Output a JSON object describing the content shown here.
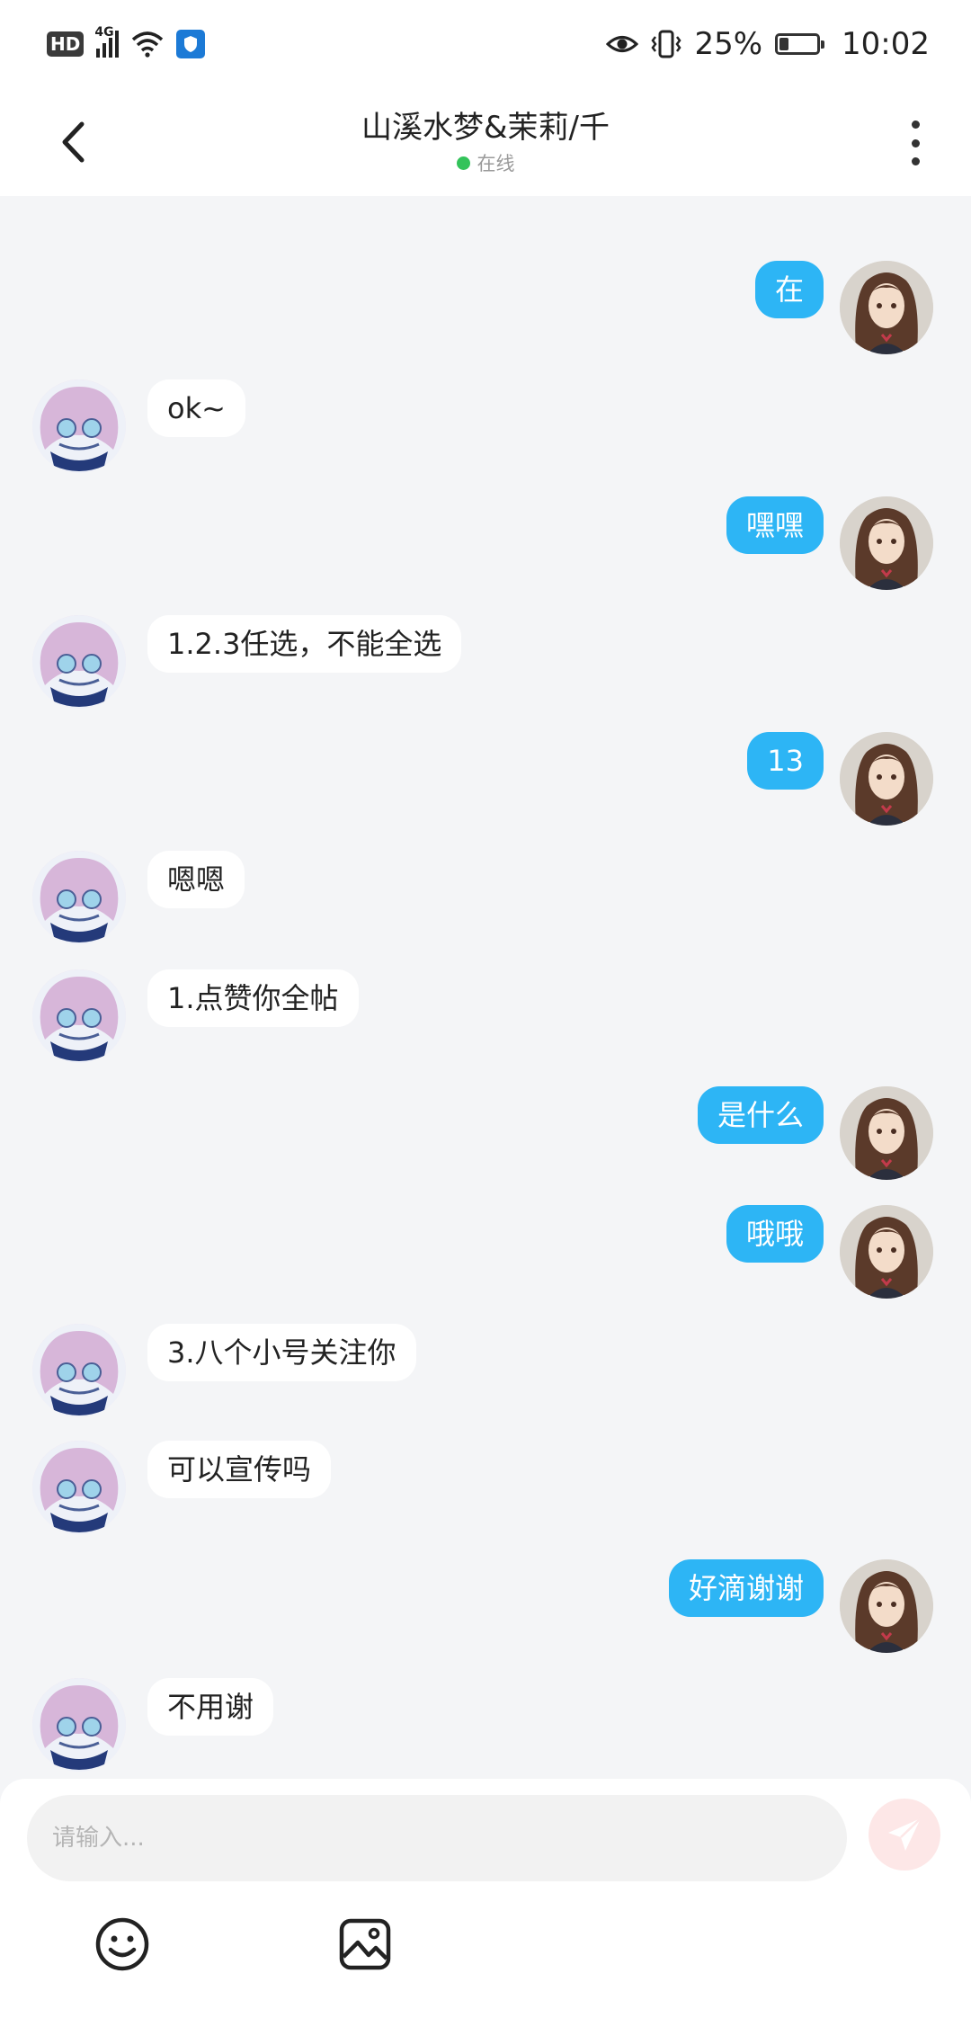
{
  "status_bar": {
    "hd": "HD",
    "network": "4G",
    "battery_percent": "25%",
    "battery_level": 0.25,
    "time": "10:02"
  },
  "header": {
    "title": "山溪水梦&茉莉/千",
    "status": "在线",
    "status_color": "#33c35a"
  },
  "messages": [
    {
      "side": "right",
      "text": "在"
    },
    {
      "side": "left",
      "text": "ok~"
    },
    {
      "side": "right",
      "text": "嘿嘿"
    },
    {
      "side": "left",
      "text": "1.2.3任选，不能全选"
    },
    {
      "side": "right",
      "text": "13"
    },
    {
      "side": "left",
      "text": "嗯嗯"
    },
    {
      "side": "left",
      "text": "1.点赞你全帖"
    },
    {
      "side": "right",
      "text": "是什么"
    },
    {
      "side": "right",
      "text": "哦哦"
    },
    {
      "side": "left",
      "text": "3.八个小号关注你"
    },
    {
      "side": "left",
      "text": "可以宣传吗"
    },
    {
      "side": "right",
      "text": "好滴谢谢"
    },
    {
      "side": "left",
      "text": "不用谢"
    }
  ],
  "input": {
    "placeholder": "请输入..."
  },
  "colors": {
    "my_bubble": "#2db5f5",
    "their_bubble": "#ffffff",
    "background": "#f4f5f7",
    "send_button": "#fde7e7"
  },
  "icons": {
    "back": "chevron-left-icon",
    "more": "more-vertical-icon",
    "send": "paper-plane-icon",
    "emoji": "smiley-icon",
    "image": "image-icon"
  }
}
